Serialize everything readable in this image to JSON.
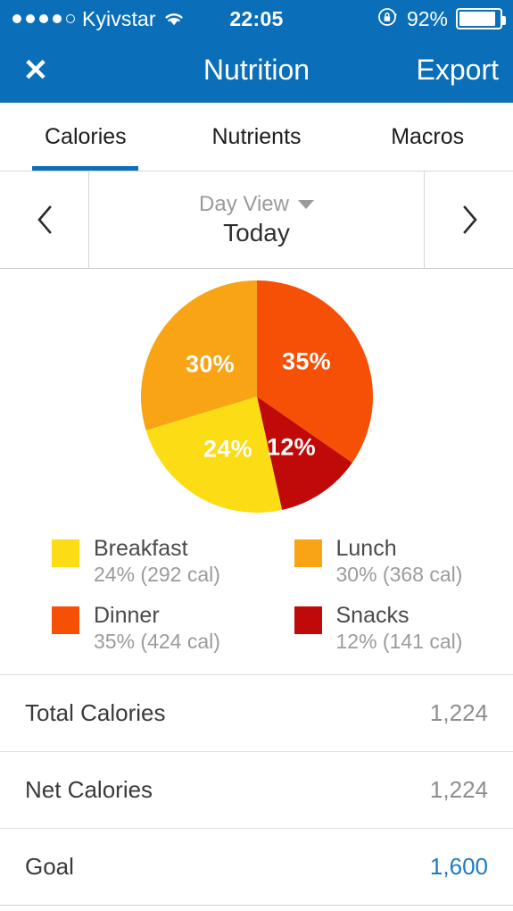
{
  "status_bar": {
    "signal_dots_filled": 4,
    "signal_dots_total": 5,
    "carrier": "Kyivstar",
    "wifi_icon": "wifi-icon",
    "time": "22:05",
    "rotation_lock_icon": "rotation-lock-icon",
    "battery_percent": "92%",
    "battery_level": 92
  },
  "nav_bar": {
    "close_icon": "✕",
    "title": "Nutrition",
    "action_label": "Export",
    "background_color": "#0a6fb8"
  },
  "tabs": {
    "active_index": 0,
    "items": [
      {
        "label": "Calories"
      },
      {
        "label": "Nutrients"
      },
      {
        "label": "Macros"
      }
    ],
    "indicator_color": "#0a6fb8"
  },
  "date_bar": {
    "prev_icon": "chevron-left-icon",
    "next_icon": "chevron-right-icon",
    "view_mode": "Day View",
    "dropdown_icon": "caret-down-icon",
    "current_date": "Today"
  },
  "chart_data": {
    "type": "pie",
    "title": "",
    "start_angle_deg": 0,
    "direction": "clockwise",
    "categories": [
      "Dinner",
      "Snacks",
      "Breakfast",
      "Lunch"
    ],
    "values": [
      35,
      12,
      24,
      30
    ],
    "slice_labels": [
      "35%",
      "12%",
      "24%",
      "30%"
    ],
    "colors": [
      "#f64f06",
      "#c00a0a",
      "#fcdc15",
      "#f9a414"
    ],
    "calories": [
      424,
      141,
      292,
      368
    ],
    "legend_position": "below",
    "legend": [
      {
        "name": "Breakfast",
        "detail": "24% (292 cal)",
        "color": "#fcdc15",
        "percent": 24,
        "calories": 292
      },
      {
        "name": "Lunch",
        "detail": "30% (368 cal)",
        "color": "#f9a414",
        "percent": 30,
        "calories": 368
      },
      {
        "name": "Dinner",
        "detail": "35% (424 cal)",
        "color": "#f64f06",
        "percent": 35,
        "calories": 424
      },
      {
        "name": "Snacks",
        "detail": "12% (141 cal)",
        "color": "#c00a0a",
        "percent": 12,
        "calories": 141
      }
    ]
  },
  "stats": [
    {
      "label": "Total Calories",
      "value": "1,224",
      "accent": false
    },
    {
      "label": "Net Calories",
      "value": "1,224",
      "accent": false
    },
    {
      "label": "Goal",
      "value": "1,600",
      "accent": true
    }
  ]
}
